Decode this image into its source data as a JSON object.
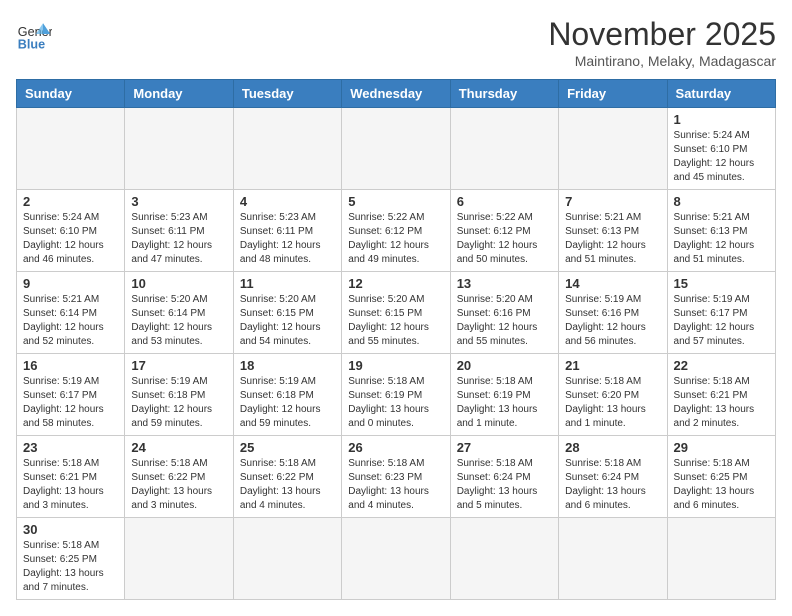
{
  "header": {
    "logo_general": "General",
    "logo_blue": "Blue",
    "month_year": "November 2025",
    "location": "Maintirano, Melaky, Madagascar"
  },
  "weekdays": [
    "Sunday",
    "Monday",
    "Tuesday",
    "Wednesday",
    "Thursday",
    "Friday",
    "Saturday"
  ],
  "weeks": [
    [
      {
        "day": "",
        "info": ""
      },
      {
        "day": "",
        "info": ""
      },
      {
        "day": "",
        "info": ""
      },
      {
        "day": "",
        "info": ""
      },
      {
        "day": "",
        "info": ""
      },
      {
        "day": "",
        "info": ""
      },
      {
        "day": "1",
        "info": "Sunrise: 5:24 AM\nSunset: 6:10 PM\nDaylight: 12 hours\nand 45 minutes."
      }
    ],
    [
      {
        "day": "2",
        "info": "Sunrise: 5:24 AM\nSunset: 6:10 PM\nDaylight: 12 hours\nand 46 minutes."
      },
      {
        "day": "3",
        "info": "Sunrise: 5:23 AM\nSunset: 6:11 PM\nDaylight: 12 hours\nand 47 minutes."
      },
      {
        "day": "4",
        "info": "Sunrise: 5:23 AM\nSunset: 6:11 PM\nDaylight: 12 hours\nand 48 minutes."
      },
      {
        "day": "5",
        "info": "Sunrise: 5:22 AM\nSunset: 6:12 PM\nDaylight: 12 hours\nand 49 minutes."
      },
      {
        "day": "6",
        "info": "Sunrise: 5:22 AM\nSunset: 6:12 PM\nDaylight: 12 hours\nand 50 minutes."
      },
      {
        "day": "7",
        "info": "Sunrise: 5:21 AM\nSunset: 6:13 PM\nDaylight: 12 hours\nand 51 minutes."
      },
      {
        "day": "8",
        "info": "Sunrise: 5:21 AM\nSunset: 6:13 PM\nDaylight: 12 hours\nand 51 minutes."
      }
    ],
    [
      {
        "day": "9",
        "info": "Sunrise: 5:21 AM\nSunset: 6:14 PM\nDaylight: 12 hours\nand 52 minutes."
      },
      {
        "day": "10",
        "info": "Sunrise: 5:20 AM\nSunset: 6:14 PM\nDaylight: 12 hours\nand 53 minutes."
      },
      {
        "day": "11",
        "info": "Sunrise: 5:20 AM\nSunset: 6:15 PM\nDaylight: 12 hours\nand 54 minutes."
      },
      {
        "day": "12",
        "info": "Sunrise: 5:20 AM\nSunset: 6:15 PM\nDaylight: 12 hours\nand 55 minutes."
      },
      {
        "day": "13",
        "info": "Sunrise: 5:20 AM\nSunset: 6:16 PM\nDaylight: 12 hours\nand 55 minutes."
      },
      {
        "day": "14",
        "info": "Sunrise: 5:19 AM\nSunset: 6:16 PM\nDaylight: 12 hours\nand 56 minutes."
      },
      {
        "day": "15",
        "info": "Sunrise: 5:19 AM\nSunset: 6:17 PM\nDaylight: 12 hours\nand 57 minutes."
      }
    ],
    [
      {
        "day": "16",
        "info": "Sunrise: 5:19 AM\nSunset: 6:17 PM\nDaylight: 12 hours\nand 58 minutes."
      },
      {
        "day": "17",
        "info": "Sunrise: 5:19 AM\nSunset: 6:18 PM\nDaylight: 12 hours\nand 59 minutes."
      },
      {
        "day": "18",
        "info": "Sunrise: 5:19 AM\nSunset: 6:18 PM\nDaylight: 12 hours\nand 59 minutes."
      },
      {
        "day": "19",
        "info": "Sunrise: 5:18 AM\nSunset: 6:19 PM\nDaylight: 13 hours\nand 0 minutes."
      },
      {
        "day": "20",
        "info": "Sunrise: 5:18 AM\nSunset: 6:19 PM\nDaylight: 13 hours\nand 1 minute."
      },
      {
        "day": "21",
        "info": "Sunrise: 5:18 AM\nSunset: 6:20 PM\nDaylight: 13 hours\nand 1 minute."
      },
      {
        "day": "22",
        "info": "Sunrise: 5:18 AM\nSunset: 6:21 PM\nDaylight: 13 hours\nand 2 minutes."
      }
    ],
    [
      {
        "day": "23",
        "info": "Sunrise: 5:18 AM\nSunset: 6:21 PM\nDaylight: 13 hours\nand 3 minutes."
      },
      {
        "day": "24",
        "info": "Sunrise: 5:18 AM\nSunset: 6:22 PM\nDaylight: 13 hours\nand 3 minutes."
      },
      {
        "day": "25",
        "info": "Sunrise: 5:18 AM\nSunset: 6:22 PM\nDaylight: 13 hours\nand 4 minutes."
      },
      {
        "day": "26",
        "info": "Sunrise: 5:18 AM\nSunset: 6:23 PM\nDaylight: 13 hours\nand 4 minutes."
      },
      {
        "day": "27",
        "info": "Sunrise: 5:18 AM\nSunset: 6:24 PM\nDaylight: 13 hours\nand 5 minutes."
      },
      {
        "day": "28",
        "info": "Sunrise: 5:18 AM\nSunset: 6:24 PM\nDaylight: 13 hours\nand 6 minutes."
      },
      {
        "day": "29",
        "info": "Sunrise: 5:18 AM\nSunset: 6:25 PM\nDaylight: 13 hours\nand 6 minutes."
      }
    ],
    [
      {
        "day": "30",
        "info": "Sunrise: 5:18 AM\nSunset: 6:25 PM\nDaylight: 13 hours\nand 7 minutes."
      },
      {
        "day": "",
        "info": ""
      },
      {
        "day": "",
        "info": ""
      },
      {
        "day": "",
        "info": ""
      },
      {
        "day": "",
        "info": ""
      },
      {
        "day": "",
        "info": ""
      },
      {
        "day": "",
        "info": ""
      }
    ]
  ]
}
